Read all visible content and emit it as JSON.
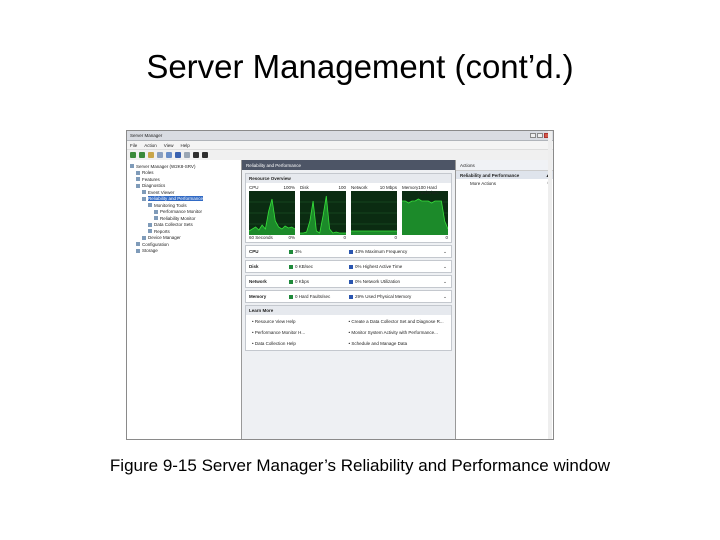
{
  "slide": {
    "title": "Server Management (cont’d.)",
    "caption": "Figure 9-15 Server Manager’s Reliability and Performance window"
  },
  "window": {
    "title": "Server Manager",
    "menu": [
      "File",
      "Action",
      "View",
      "Help"
    ]
  },
  "tree": {
    "items": [
      {
        "label": "Server Manager (W2K8-SRV)",
        "indent": 0
      },
      {
        "label": "Roles",
        "indent": 1
      },
      {
        "label": "Features",
        "indent": 1
      },
      {
        "label": "Diagnostics",
        "indent": 1
      },
      {
        "label": "Event Viewer",
        "indent": 2
      },
      {
        "label": "Reliability and Performance",
        "indent": 2,
        "selected": true
      },
      {
        "label": "Monitoring Tools",
        "indent": 3
      },
      {
        "label": "Performance Monitor",
        "indent": 4
      },
      {
        "label": "Reliability Monitor",
        "indent": 4
      },
      {
        "label": "Data Collector Sets",
        "indent": 3
      },
      {
        "label": "Reports",
        "indent": 3
      },
      {
        "label": "Device Manager",
        "indent": 2
      },
      {
        "label": "Configuration",
        "indent": 1
      },
      {
        "label": "Storage",
        "indent": 1
      }
    ]
  },
  "center": {
    "header": "Reliability and Performance",
    "overview_title": "Resource Overview",
    "graphs": [
      {
        "name": "CPU",
        "value": "100%",
        "foot_left": "60 Seconds",
        "foot_right": "0%"
      },
      {
        "name": "Disk",
        "value": "100",
        "foot_left": "",
        "foot_right": "0"
      },
      {
        "name": "Network",
        "value": "10 Mbps",
        "foot_left": "",
        "foot_right": "0"
      },
      {
        "name": "Memory",
        "value": "100 Hard Faults/sec",
        "foot_left": "",
        "foot_right": "0"
      }
    ],
    "stats": [
      {
        "name": "CPU",
        "v1": "3%",
        "v2": "43% Maximum Frequency",
        "c1": "#1f8a3a",
        "c2": "#2a55b0"
      },
      {
        "name": "Disk",
        "v1": "0 KB/sec",
        "v2": "0% Highest Active Time",
        "c1": "#1f8a3a",
        "c2": "#2a55b0"
      },
      {
        "name": "Network",
        "v1": "0 Kbps",
        "v2": "0% Network Utilization",
        "c1": "#1f8a3a",
        "c2": "#2a55b0"
      },
      {
        "name": "Memory",
        "v1": "0 Hard Faults/sec",
        "v2": "29% Used Physical Memory",
        "c1": "#1f8a3a",
        "c2": "#2a55b0"
      }
    ],
    "learn_title": "Learn More",
    "learn_links": [
      "Resource View Help",
      "Create a Data Collector Set and Diagnose R...",
      "Performance Monitor H...",
      "Monitor System Activity with Performance...",
      "Data Collection Help",
      "Schedule and Manage Data"
    ]
  },
  "actions": {
    "header": "Actions",
    "sub": "Reliability and Performance",
    "items": [
      "More Actions"
    ]
  },
  "colors": {
    "graph_bg": "#0b2c12",
    "graph_line": "#36e03a",
    "graph_fill": "#1c8a2a",
    "center_head": "#4d5566"
  }
}
